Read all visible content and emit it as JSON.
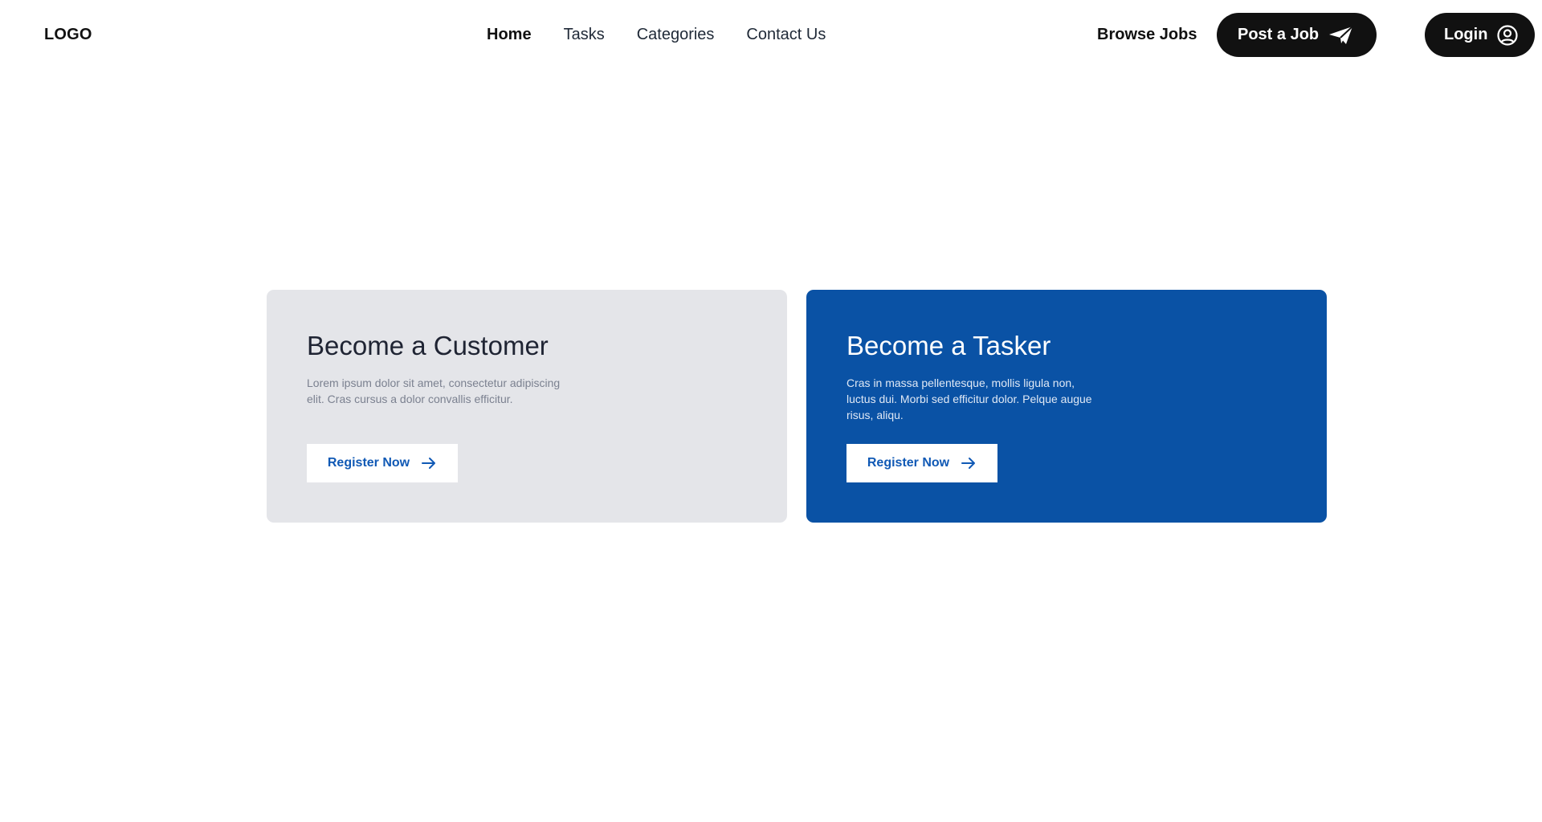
{
  "header": {
    "logo": "LOGO",
    "nav": [
      {
        "label": "Home",
        "active": true
      },
      {
        "label": "Tasks",
        "active": false
      },
      {
        "label": "Categories",
        "active": false
      },
      {
        "label": "Contact Us",
        "active": false
      }
    ],
    "browse_jobs": "Browse Jobs",
    "post_job": {
      "label": "Post a Job",
      "icon": "paper-plane-icon"
    },
    "login": {
      "label": "Login",
      "icon": "user-circle-icon"
    }
  },
  "cards": {
    "customer": {
      "title": "Become a Customer",
      "description": "Lorem ipsum dolor sit amet, consectetur adipiscing elit. Cras cursus a dolor convallis efficitur.",
      "button": "Register Now",
      "background": "#e4e5e9"
    },
    "tasker": {
      "title": "Become a Tasker",
      "description": "Cras in massa pellentesque, mollis ligula non, luctus dui. Morbi sed efficitur dolor. Pelque augue risus, aliqu.",
      "button": "Register Now",
      "background": "#0a52a5"
    }
  },
  "colors": {
    "accent": "#0a52a5",
    "button_text": "#1059b5",
    "dark": "#111111"
  }
}
